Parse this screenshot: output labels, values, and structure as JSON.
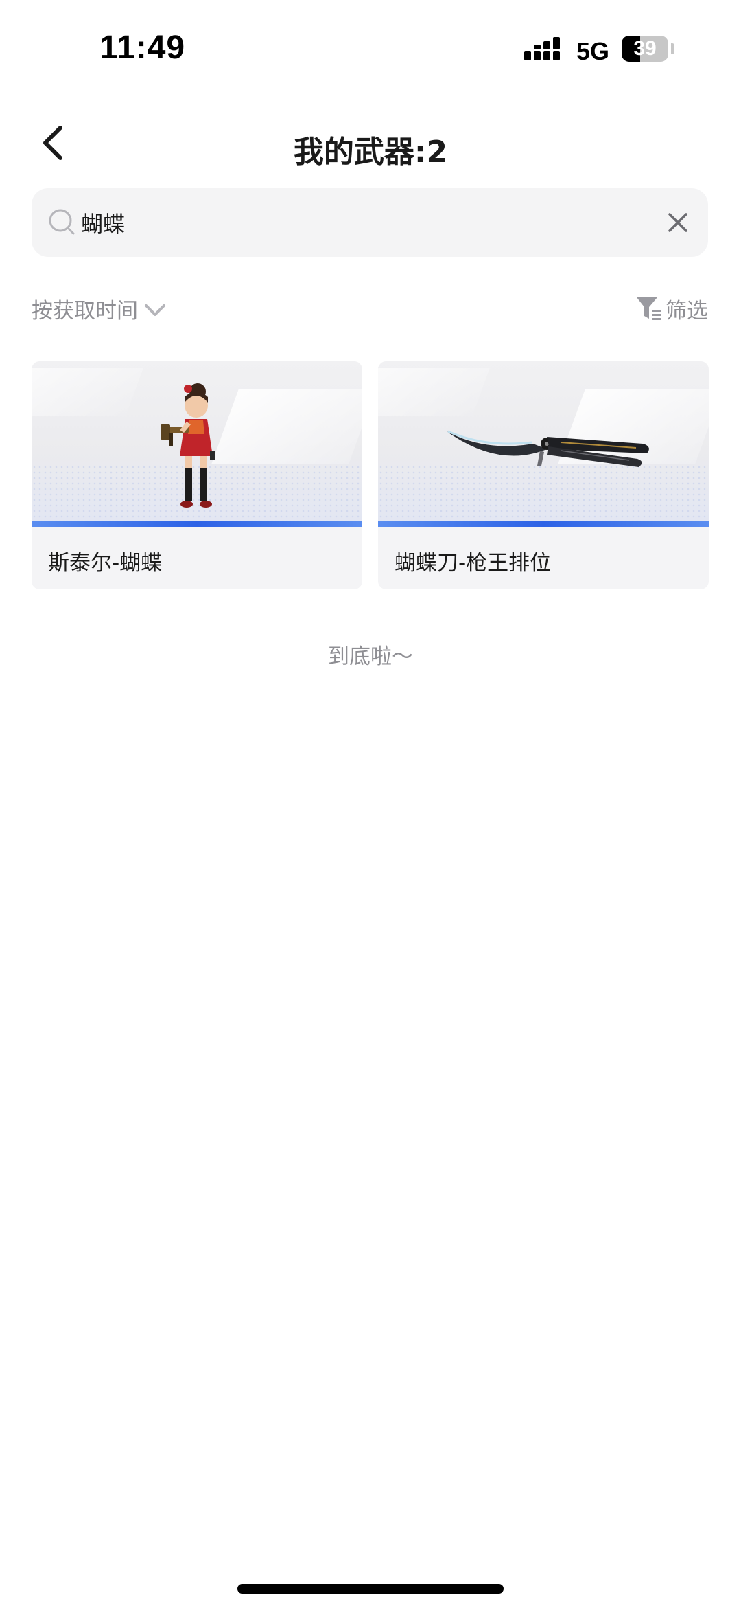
{
  "status_bar": {
    "time": "11:49",
    "network": "5G",
    "battery": "39",
    "battery_level_percent": 39
  },
  "header": {
    "back_icon": "chevron-left-icon",
    "title": "我的武器:2"
  },
  "search": {
    "value": "蝴蝶",
    "search_icon": "search-icon",
    "clear_icon": "close-icon"
  },
  "toolbar": {
    "sort_label": "按获取时间",
    "sort_icon": "chevron-down-icon",
    "filter_label": "筛选",
    "filter_icon": "filter-icon"
  },
  "items": [
    {
      "name": "斯泰尔-蝴蝶",
      "image": "character-with-gun"
    },
    {
      "name": "蝴蝶刀-枪王排位",
      "image": "butterfly-knife"
    }
  ],
  "end_of_list": "到底啦～",
  "colors": {
    "accent_blue": "#2d62e6",
    "muted_text": "#8e8e93",
    "card_bg": "#f4f4f6",
    "search_bg": "#f4f4f5"
  }
}
